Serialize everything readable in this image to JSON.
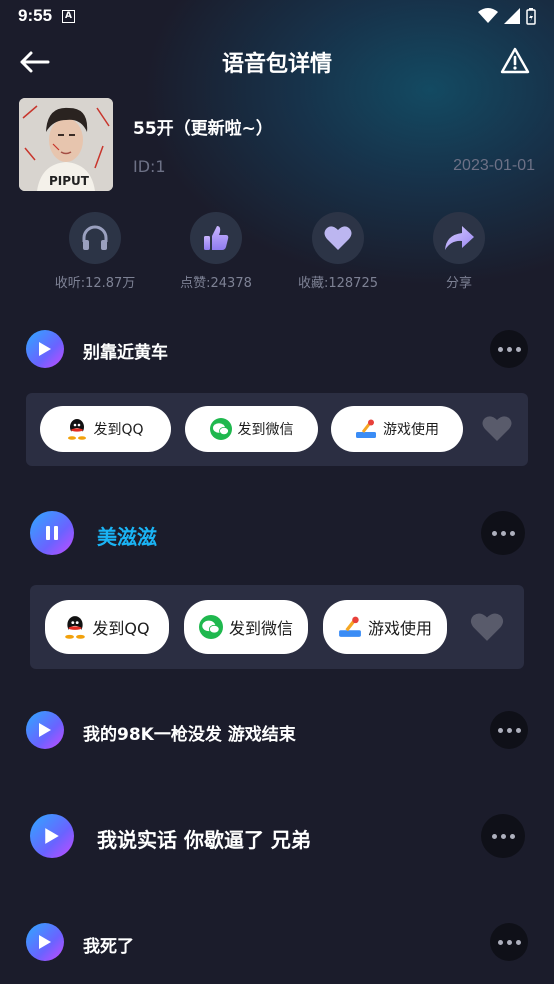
{
  "status_bar": {
    "time": "9:55",
    "badge": "A"
  },
  "header": {
    "title": "语音包详情"
  },
  "pack": {
    "name": "55开（更新啦~）",
    "id": "ID:1",
    "date": "2023-01-01",
    "cover_text": "PIPUT"
  },
  "stats": [
    {
      "icon": "headphones-icon",
      "label": "收听:12.87万"
    },
    {
      "icon": "thumbs-up-icon",
      "label": "点赞:24378"
    },
    {
      "icon": "heart-icon",
      "label": "收藏:128725"
    },
    {
      "icon": "share-icon",
      "label": "分享"
    }
  ],
  "share_actions": {
    "qq": "发到QQ",
    "wechat": "发到微信",
    "game": "游戏使用"
  },
  "voices": [
    {
      "title": "别靠近黄车",
      "state": "stopped"
    },
    {
      "title": "美滋滋",
      "state": "playing"
    },
    {
      "title": "我的98K一枪没发 游戏结束",
      "state": "stopped"
    },
    {
      "title": "我说实话 你歇逼了 兄弟",
      "state": "stopped"
    },
    {
      "title": "我死了",
      "state": "stopped"
    }
  ],
  "colors": {
    "background": "#1b1c2b",
    "active_title": "#1ab4f5",
    "panel": "#2b2e42",
    "muted_text": "#6d7186"
  }
}
